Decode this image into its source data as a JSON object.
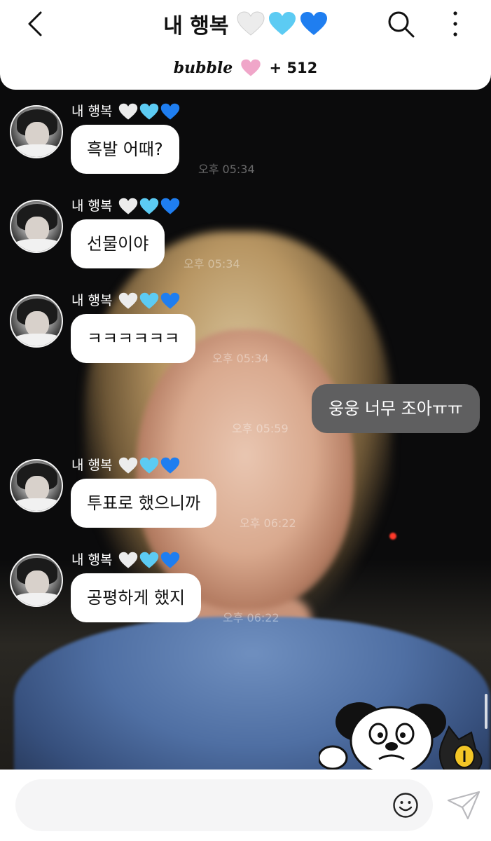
{
  "header": {
    "title": "내 행복",
    "bubble_brand": "bubble",
    "bubble_count": "+ 512"
  },
  "colors": {
    "heart_white": "#ececec",
    "heart_light_blue": "#5ccbf3",
    "heart_blue": "#1f7ef0",
    "heart_pink": "#f0a6c9",
    "my_bubble": "#5f5f60"
  },
  "icons": {
    "back": "chevron-left-icon",
    "search": "search-icon",
    "more": "more-vertical-icon",
    "emoji": "smiley-icon",
    "send": "paper-plane-icon"
  },
  "messages": [
    {
      "from": "artist",
      "sender": "내 행복",
      "text": "흑발 어때?",
      "time": "오후 05:34"
    },
    {
      "from": "artist",
      "sender": "내 행복",
      "text": "선물이야",
      "time": "오후 05:34"
    },
    {
      "from": "artist",
      "sender": "내 행복",
      "text": "ㅋㅋㅋㅋㅋㅋ",
      "time": "오후 05:34"
    },
    {
      "from": "me",
      "text": "웅웅 너무 조아ㅠㅠ",
      "time": "오후 05:59"
    },
    {
      "from": "artist",
      "sender": "내 행복",
      "text": "투표로 했으니까",
      "time": "오후 06:22"
    },
    {
      "from": "artist",
      "sender": "내 행복",
      "text": "공평하게 했지",
      "time": "오후 06:22"
    }
  ],
  "input": {
    "placeholder": "",
    "value": ""
  }
}
